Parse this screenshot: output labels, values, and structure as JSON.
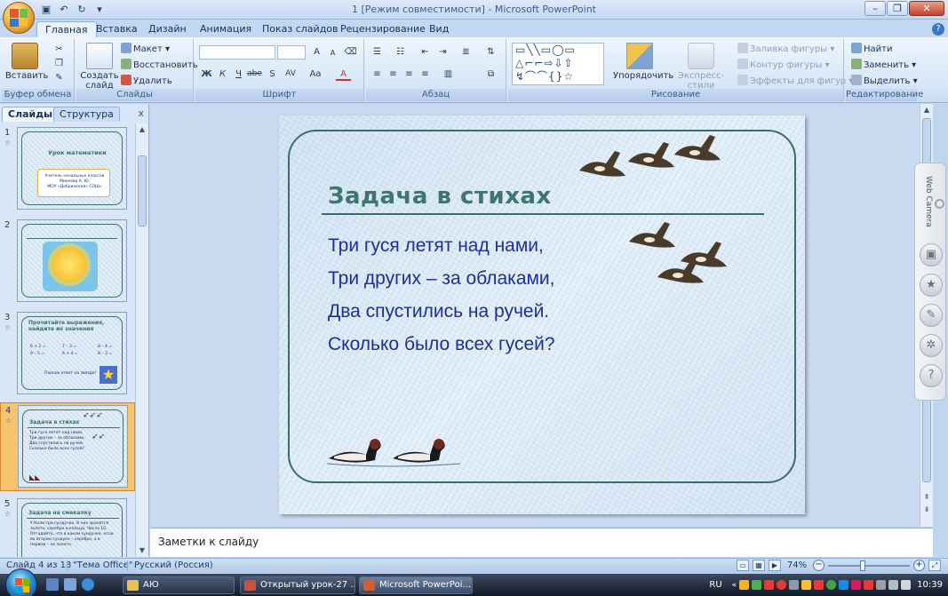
{
  "window": {
    "title": "1 [Режим совместимости] - Microsoft PowerPoint",
    "controls": [
      "–",
      "❐",
      "✕"
    ]
  },
  "ribbon_tabs": [
    "Главная",
    "Вставка",
    "Дизайн",
    "Анимация",
    "Показ слайдов",
    "Рецензирование",
    "Вид"
  ],
  "ribbon": {
    "clipboard": {
      "label": "Буфер обмена",
      "paste": "Вставить"
    },
    "slides": {
      "label": "Слайды",
      "create": "Создать слайд",
      "layout": "Макет",
      "reset": "Восстановить",
      "delete": "Удалить"
    },
    "font": {
      "label": "Шрифт",
      "bold": "Ж",
      "italic": "К",
      "underline": "Ч",
      "strike": "abe",
      "shadow": "S",
      "spacing": "AV",
      "case": "Aa",
      "grow": "A",
      "shrink": "A",
      "color": "A"
    },
    "paragraph": {
      "label": "Абзац"
    },
    "drawing": {
      "label": "Рисование",
      "arrange": "Упорядочить",
      "quick_styles": "Экспресс-стили",
      "fill": "Заливка фигуры",
      "outline": "Контур фигуры",
      "effects": "Эффекты для фигур"
    },
    "editing": {
      "label": "Редактирование",
      "find": "Найти",
      "replace": "Заменить",
      "select": "Выделить"
    }
  },
  "left_pane": {
    "tabs": [
      "Слайды",
      "Структура"
    ],
    "close": "x",
    "thumbnails": [
      {
        "num": "1",
        "title": "Урок математики",
        "body": [
          "Учитель начальных классов",
          "Михеева А. Ю.",
          "МОУ «Добринская» СОШ»"
        ]
      },
      {
        "num": "2",
        "title": "",
        "body": []
      },
      {
        "num": "3",
        "title": "Прочитайте выражения, найдите их значения",
        "body": [
          "6 + 2 =",
          "7 – 3 =",
          "8 – 4 =",
          "9 – 5 =",
          "6 + 4 =",
          "8 – 3 =",
          "Поиски ответ на звезде!"
        ]
      },
      {
        "num": "4",
        "title": "Задача в стихах",
        "body": [
          "Три гуся летят над нами,",
          "Три других – за облаками,",
          "Два спустились на ручей.",
          "Сколько было всех гусей?"
        ]
      },
      {
        "num": "5",
        "title": "Задача на смекалку",
        "body": [
          "У Коли три сундучка. В них хранятся",
          "золото, серебро и кольца. Числа 10.",
          "Отгадайте, что в каком сундучке, если",
          "во втором сундуке – серебро, а в",
          "первом – не золото."
        ]
      }
    ]
  },
  "slide": {
    "title": "Задача в стихах",
    "lines": [
      "Три гуся летят над нами,",
      "Три других – за облаками,",
      "Два спустились на ручей.",
      "Сколько было всех гусей?"
    ]
  },
  "notes": {
    "placeholder": "Заметки к слайду"
  },
  "webcam": {
    "label": "Web Camera"
  },
  "status": {
    "slide": "Слайд 4 из 13",
    "theme": "\"Тема Office\"",
    "language": "Русский (Россия)",
    "zoom": "74%"
  },
  "taskbar": {
    "items": [
      "АЮ",
      "Открытый урок-27 ...",
      "Microsoft PowerPoi..."
    ],
    "lang": "RU",
    "clock": "10:39"
  },
  "colors": {
    "ribbon_bg": "#dfeafa",
    "slide_title": "#3e7570",
    "slide_text": "#1d2f99",
    "frame": "#3d6d68",
    "active_thumb": "#f7c46e"
  }
}
